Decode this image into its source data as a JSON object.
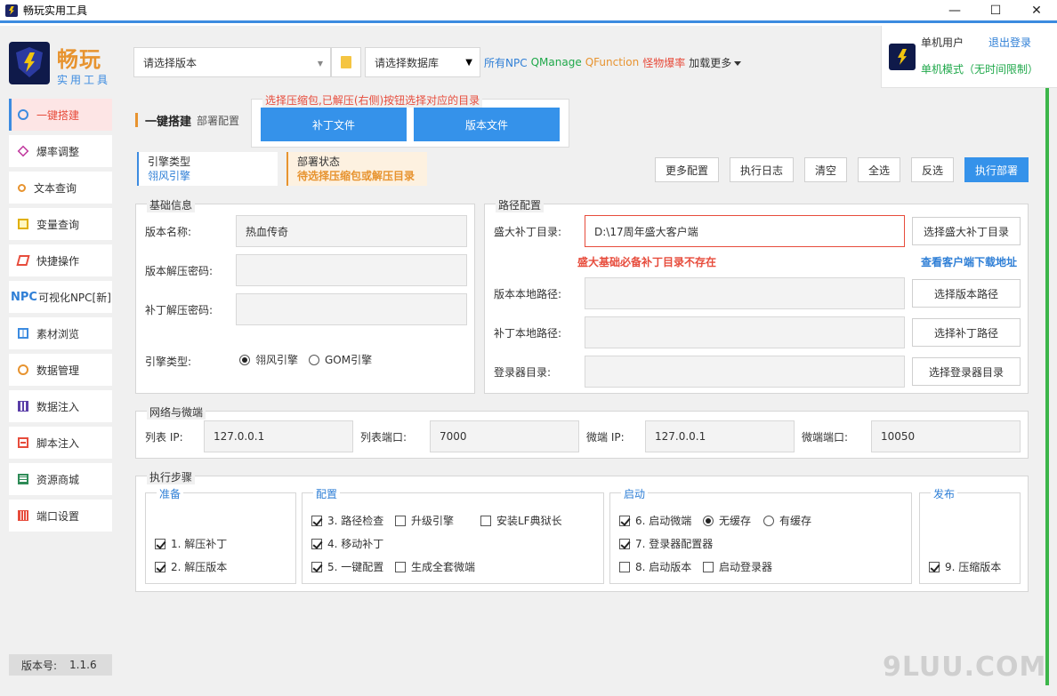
{
  "window": {
    "title": "畅玩实用工具",
    "minimize": "—",
    "maximize": "☐",
    "close": "✕"
  },
  "logo": {
    "brand": "畅玩",
    "sub": "实用工具"
  },
  "sidebar": {
    "items": [
      {
        "label": "一键搭建",
        "icon": "gear-icon"
      },
      {
        "label": "爆率调整",
        "icon": "diamond-icon"
      },
      {
        "label": "文本查询",
        "icon": "search-icon"
      },
      {
        "label": "变量查询",
        "icon": "box-icon"
      },
      {
        "label": "快捷操作",
        "icon": "eraser-icon"
      },
      {
        "label": "可视化NPC[新]",
        "icon": "npc-icon",
        "prefix": "NPC"
      },
      {
        "label": "素材浏览",
        "icon": "columns-icon"
      },
      {
        "label": "数据管理",
        "icon": "ring-icon"
      },
      {
        "label": "数据注入",
        "icon": "grid-icon"
      },
      {
        "label": "脚本注入",
        "icon": "document-icon"
      },
      {
        "label": "资源商城",
        "icon": "list-icon"
      },
      {
        "label": "端口设置",
        "icon": "bars-icon"
      }
    ],
    "version_label": "版本号:",
    "version_value": "1.1.6"
  },
  "topbar": {
    "version_select": "请选择版本",
    "db_select": "请选择数据库",
    "links": {
      "npc": "所有NPC",
      "qmanage": "QManage",
      "qfunction": "QFunction",
      "boss": "怪物爆率",
      "more": "加载更多"
    }
  },
  "user": {
    "name": "单机用户",
    "logout": "退出登录",
    "mode": "单机模式（无时间限制）"
  },
  "heading": {
    "title": "一键搭建",
    "subtitle": "部署配置"
  },
  "compress": {
    "legend": "选择压缩包,已解压(右侧)按钮选择对应的目录",
    "patch_btn": "补丁文件",
    "version_btn": "版本文件"
  },
  "engine": {
    "label": "引擎类型",
    "value": "翎风引擎"
  },
  "status": {
    "label": "部署状态",
    "value": "待选择压缩包或解压目录"
  },
  "actions": {
    "more": "更多配置",
    "log": "执行日志",
    "clear": "清空",
    "all": "全选",
    "invert": "反选",
    "deploy": "执行部署"
  },
  "basic": {
    "legend": "基础信息",
    "name_label": "版本名称:",
    "name_value": "热血传奇",
    "vpwd_label": "版本解压密码:",
    "vpwd_value": "",
    "ppwd_label": "补丁解压密码:",
    "ppwd_value": "",
    "engine_label": "引擎类型:",
    "engine_opt1": "翎风引擎",
    "engine_opt2": "GOM引擎"
  },
  "paths": {
    "legend": "路径配置",
    "sd_label": "盛大补丁目录:",
    "sd_value": "D:\\17周年盛大客户端",
    "sd_btn": "选择盛大补丁目录",
    "sd_error": "盛大基础必备补丁目录不存在",
    "client_link": "查看客户端下载地址",
    "ver_label": "版本本地路径:",
    "ver_value": "",
    "ver_btn": "选择版本路径",
    "patch_label": "补丁本地路径:",
    "patch_value": "",
    "patch_btn": "选择补丁路径",
    "login_label": "登录器目录:",
    "login_value": "",
    "login_btn": "选择登录器目录"
  },
  "network": {
    "legend": "网络与微端",
    "list_ip_label": "列表 IP:",
    "list_ip": "127.0.0.1",
    "list_port_label": "列表端口:",
    "list_port": "7000",
    "micro_ip_label": "微端 IP:",
    "micro_ip": "127.0.0.1",
    "micro_port_label": "微端端口:",
    "micro_port": "10050"
  },
  "steps": {
    "legend": "执行步骤",
    "prepare": {
      "legend": "准备",
      "s1": "1. 解压补丁",
      "s2": "2. 解压版本"
    },
    "config": {
      "legend": "配置",
      "s3": "3. 路径检查",
      "upgrade": "升级引擎",
      "lf": "安装LF典狱长",
      "s4": "4. 移动补丁",
      "s5": "5. 一键配置",
      "micro_all": "生成全套微端"
    },
    "start": {
      "legend": "启动",
      "s6": "6. 启动微端",
      "nocache": "无缓存",
      "cache": "有缓存",
      "s7": "7. 登录器配置器",
      "s8": "8. 启动版本",
      "start_login": "启动登录器"
    },
    "publish": {
      "legend": "发布",
      "s9": "9. 压缩版本"
    }
  },
  "watermark": "9LUU.COM"
}
